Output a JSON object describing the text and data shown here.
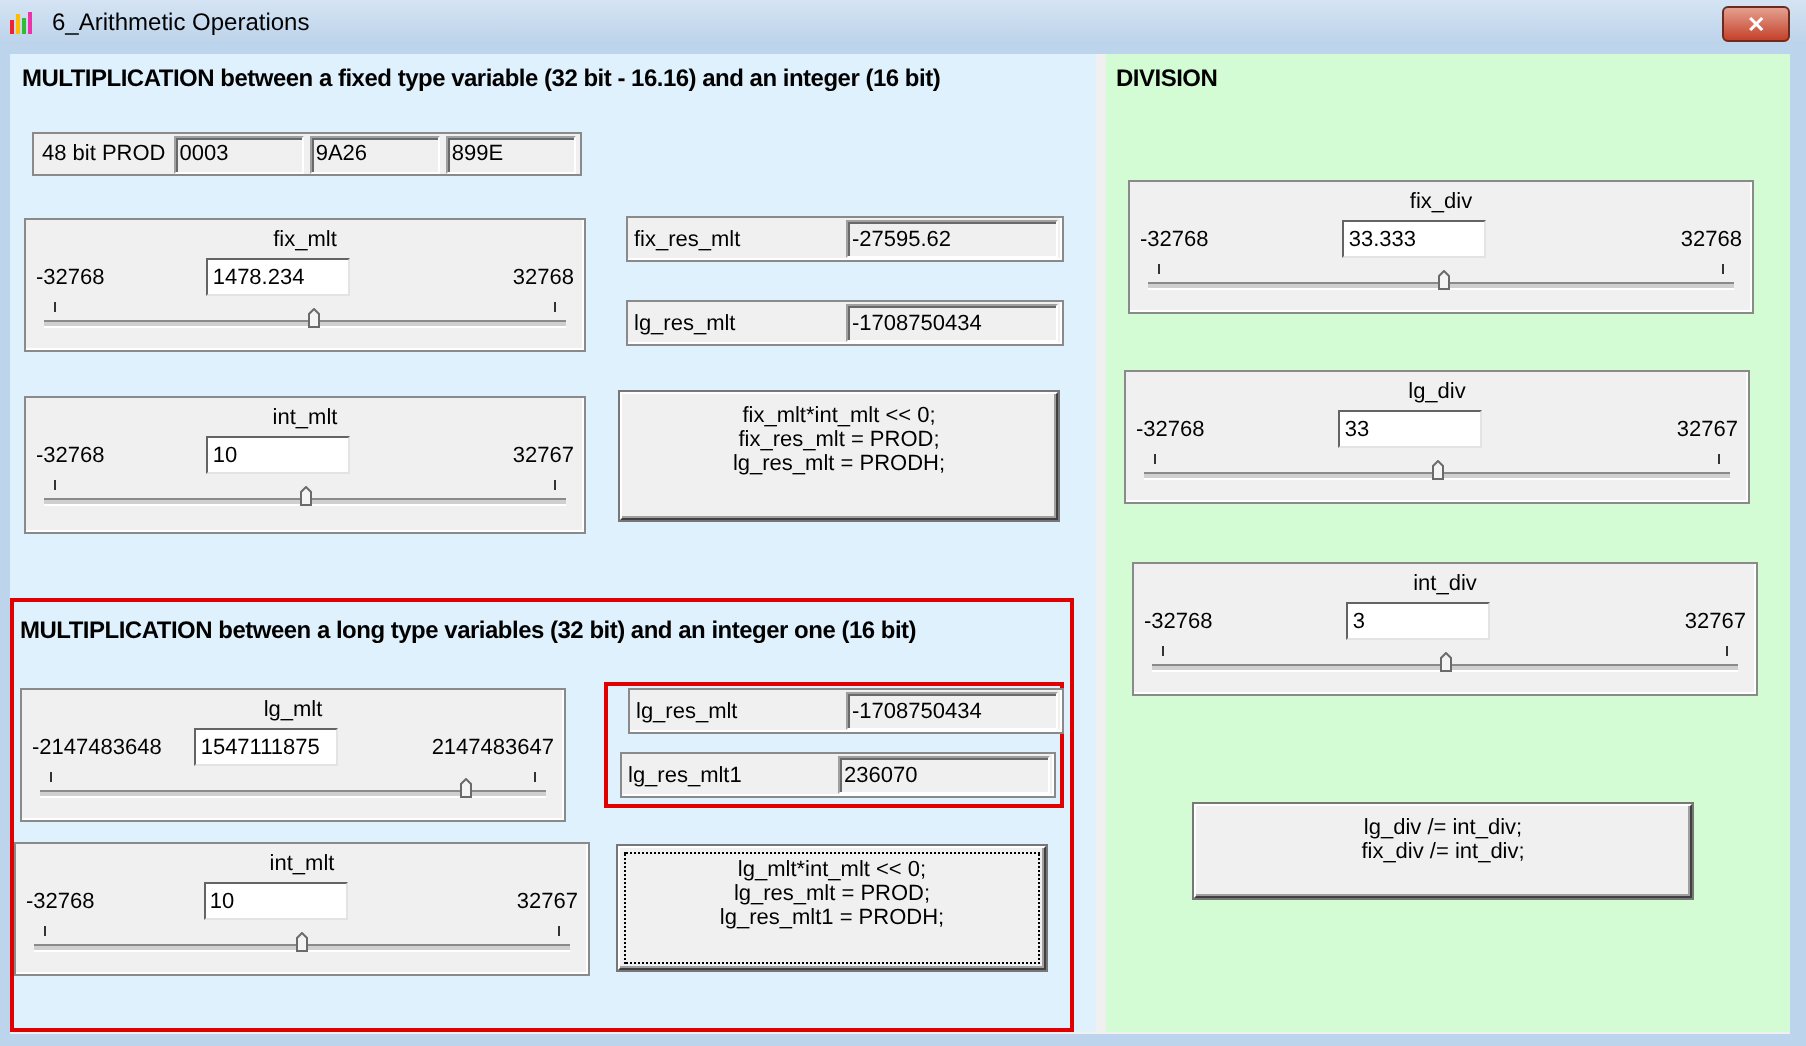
{
  "window": {
    "title": "6_Arithmetic Operations",
    "close_button": "✕"
  },
  "fixed_multiplication": {
    "heading": "MULTIPLICATION between a fixed type variable (32 bit - 16.16) and an integer (16 bit)",
    "prod": {
      "label": "48 bit PROD",
      "values": [
        "0003",
        "9A26",
        "899E"
      ]
    },
    "sliders": [
      {
        "label": "fix_mlt",
        "min": "-32768",
        "value": "1478.234",
        "max": "32768",
        "level": 0.52
      },
      {
        "label": "int_mlt",
        "min": "-32768",
        "value": "10",
        "max": "32767",
        "level": 0.5
      }
    ],
    "results": [
      {
        "label": "fix_res_mlt",
        "value": "-27595.62"
      },
      {
        "label": "lg_res_mlt",
        "value": "-1708750434"
      }
    ],
    "button": {
      "label": "fix_mlt*int_mlt << 0;\nfix_res_mlt = PROD;\nlg_res_mlt = PRODH;",
      "focused": false
    }
  },
  "long_multiplication": {
    "heading": "MULTIPLICATION between a long type variables (32 bit) and an integer one (16 bit)",
    "sliders": [
      {
        "label": "lg_mlt",
        "min": "-2147483648",
        "value": "1547111875",
        "max": "2147483647",
        "level": 0.86
      },
      {
        "label": "int_mlt",
        "min": "-32768",
        "value": "10",
        "max": "32767",
        "level": 0.5
      }
    ],
    "results": [
      {
        "label": "lg_res_mlt",
        "value": "-1708750434"
      },
      {
        "label": "lg_res_mlt1",
        "value": "236070"
      }
    ],
    "button": {
      "label": "lg_mlt*int_mlt << 0;\nlg_res_mlt = PROD;\nlg_res_mlt1 = PRODH;",
      "focused": true
    }
  },
  "division": {
    "heading": "DIVISION",
    "sliders": [
      {
        "label": "fix_div",
        "min": "-32768",
        "value": "33.333",
        "max": "32768",
        "level": 0.505
      },
      {
        "label": "lg_div",
        "min": "-32768",
        "value": "33",
        "max": "32767",
        "level": 0.5
      },
      {
        "label": "int_div",
        "min": "-32768",
        "value": "3",
        "max": "32767",
        "level": 0.5
      }
    ],
    "button": {
      "label": "lg_div /= int_div;\nfix_div /= int_div;",
      "focused": false
    }
  }
}
